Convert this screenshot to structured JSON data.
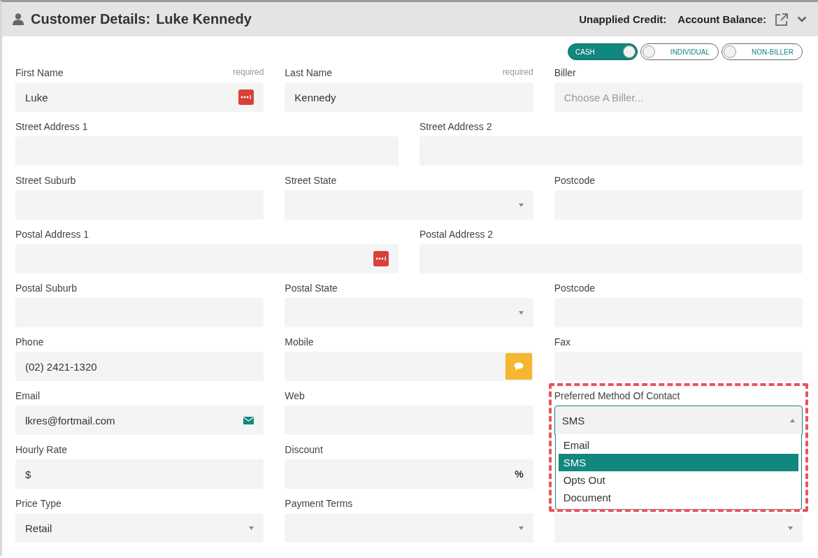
{
  "header": {
    "title": "Customer Details:",
    "name": "Luke Kennedy",
    "unapplied_credit": "Unapplied Credit:",
    "account_balance": "Account Balance:"
  },
  "toggles": [
    {
      "label": "CASH",
      "on": true
    },
    {
      "label": "INDIVIDUAL",
      "on": false
    },
    {
      "label": "NON-BILLER",
      "on": false
    }
  ],
  "rows": [
    {
      "fields": [
        {
          "label": "First Name",
          "note": "required",
          "kind": "secured",
          "value": "Luke"
        },
        {
          "label": "Last Name",
          "note": "required",
          "kind": "text",
          "value": "Kennedy"
        },
        {
          "label": "Biller",
          "kind": "text",
          "placeholder": "Choose A Biller..."
        }
      ]
    },
    {
      "fields": [
        {
          "label": "Street Address 1",
          "kind": "text"
        },
        {
          "label": "Street Address 2",
          "kind": "text"
        }
      ]
    },
    {
      "fields": [
        {
          "label": "Street Suburb",
          "kind": "text"
        },
        {
          "label": "Street State",
          "kind": "select"
        },
        {
          "label": "Postcode",
          "kind": "text"
        }
      ]
    },
    {
      "fields": [
        {
          "label": "Postal Address 1",
          "kind": "secured"
        },
        {
          "label": "Postal Address 2",
          "kind": "text"
        }
      ]
    },
    {
      "fields": [
        {
          "label": "Postal Suburb",
          "kind": "text"
        },
        {
          "label": "Postal State",
          "kind": "select"
        },
        {
          "label": "Postcode",
          "kind": "text"
        }
      ]
    },
    {
      "fields": [
        {
          "label": "Phone",
          "kind": "text",
          "value": "(02) 2421-1320"
        },
        {
          "label": "Mobile",
          "kind": "mobile"
        },
        {
          "label": "Fax",
          "kind": "text"
        }
      ]
    },
    {
      "fields": [
        {
          "label": "Email",
          "kind": "email",
          "value": "lkres@fortmail.com"
        },
        {
          "label": "Web",
          "kind": "text"
        },
        {
          "label": "Preferred Method Of Contact",
          "kind": "select",
          "value": "SMS",
          "open": true,
          "highlighted": true,
          "options": [
            {
              "label": "Email",
              "selected": false
            },
            {
              "label": "SMS",
              "selected": true
            },
            {
              "label": "Opts Out",
              "selected": false
            },
            {
              "label": "Document",
              "selected": false
            }
          ]
        }
      ]
    },
    {
      "fields": [
        {
          "label": "Hourly Rate",
          "kind": "text",
          "prefix": "$"
        },
        {
          "label": "Discount",
          "kind": "text",
          "suffix": "%"
        },
        {
          "kind": "spacer"
        }
      ]
    },
    {
      "fields": [
        {
          "label": "Price Type",
          "kind": "select",
          "value": "Retail"
        },
        {
          "label": "Payment Terms",
          "kind": "select"
        },
        {
          "kind": "select"
        }
      ]
    }
  ]
}
